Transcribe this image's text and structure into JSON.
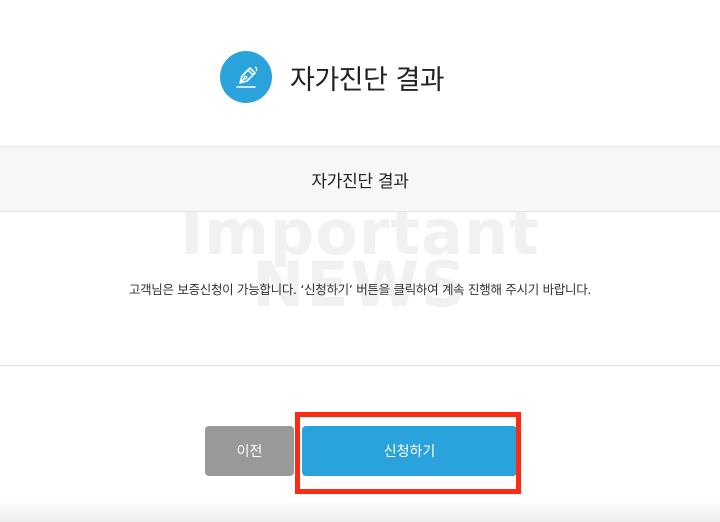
{
  "header": {
    "title": "자가진단 결과",
    "icon": "pen-nib-icon"
  },
  "section": {
    "title": "자가진단 결과"
  },
  "watermark": {
    "line1": "Important",
    "line2": "NEWS"
  },
  "content": {
    "message": "고객님은 보증신청이 가능합니다. ‘신청하기’ 버튼을 클릭하여 계속 진행해 주시기 바랍니다."
  },
  "buttons": {
    "prev_label": "이전",
    "apply_label": "신청하기"
  },
  "colors": {
    "accent": "#2aa3dc",
    "secondary_button": "#999999",
    "highlight": "#ff2a14"
  }
}
